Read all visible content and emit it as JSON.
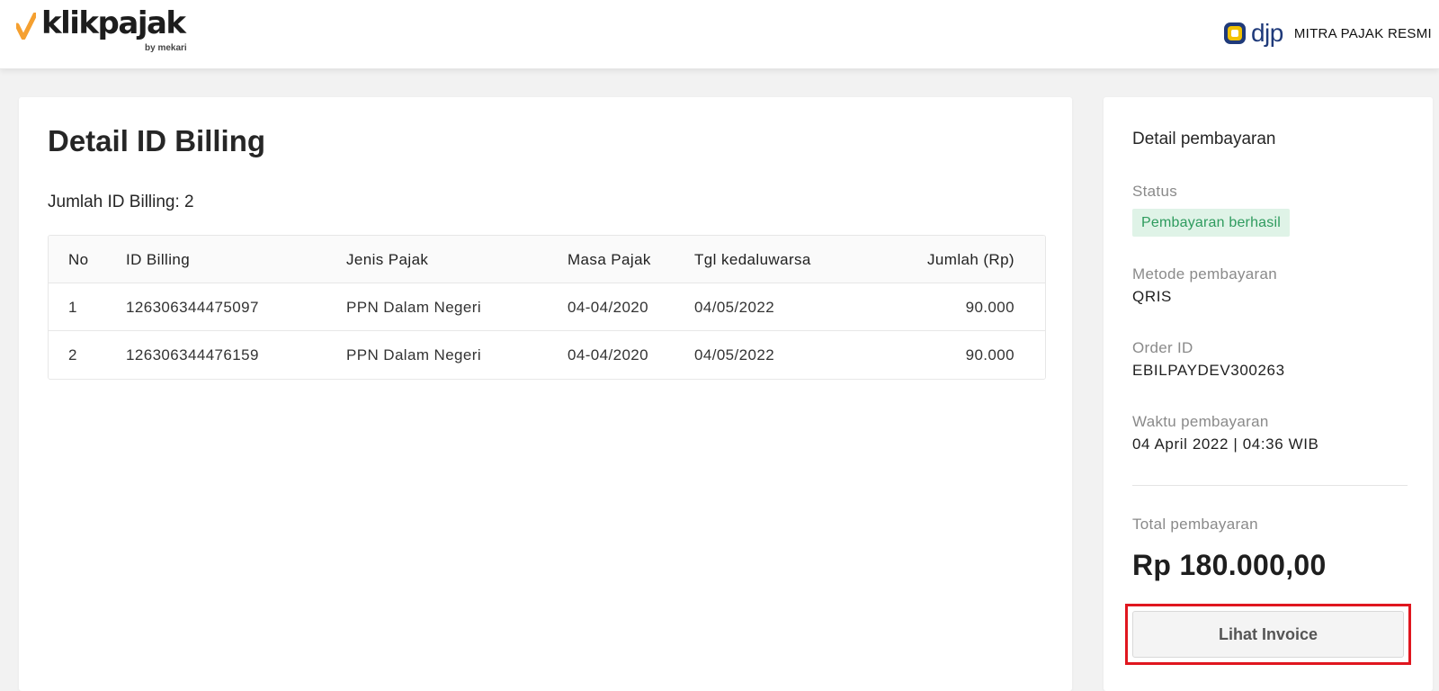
{
  "header": {
    "brand_name": "klikpajak",
    "brand_sub": "by mekari",
    "partner_name": "djp",
    "partner_tagline": "MITRA PAJAK RESMI"
  },
  "main": {
    "title": "Detail ID Billing",
    "count_label": "Jumlah ID Billing: 2",
    "table": {
      "columns": [
        "No",
        "ID Billing",
        "Jenis Pajak",
        "Masa Pajak",
        "Tgl kedaluwarsa",
        "Jumlah (Rp)"
      ],
      "rows": [
        [
          "1",
          "126306344475097",
          "PPN Dalam Negeri",
          "04-04/2020",
          "04/05/2022",
          "90.000"
        ],
        [
          "2",
          "126306344476159",
          "PPN Dalam Negeri",
          "04-04/2020",
          "04/05/2022",
          "90.000"
        ]
      ]
    }
  },
  "side": {
    "title": "Detail pembayaran",
    "status_label": "Status",
    "status_value": "Pembayaran berhasil",
    "method_label": "Metode pembayaran",
    "method_value": "QRIS",
    "order_label": "Order ID",
    "order_value": "EBILPAYDEV300263",
    "time_label": "Waktu pembayaran",
    "time_value": "04 April 2022 | 04:36 WIB",
    "total_label": "Total pembayaran",
    "total_value": "Rp 180.000,00",
    "invoice_button": "Lihat Invoice"
  },
  "colors": {
    "brand_orange": "#f5a030",
    "status_green": "#2e9b5e",
    "status_green_bg": "#dff3e7",
    "highlight_red": "#e0161f",
    "djp_blue": "#1f3a7a",
    "djp_yellow": "#f2c200"
  }
}
